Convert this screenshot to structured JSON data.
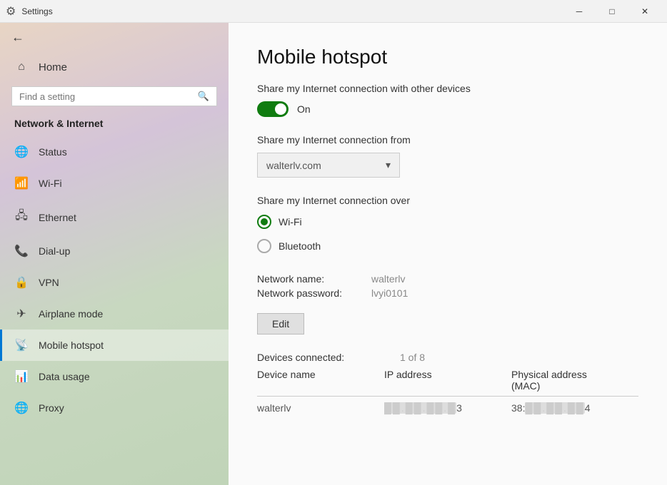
{
  "titleBar": {
    "title": "Settings",
    "minBtn": "─",
    "maxBtn": "□",
    "closeBtn": "✕"
  },
  "sidebar": {
    "backLabel": "",
    "homeLabel": "Home",
    "searchPlaceholder": "Find a setting",
    "sectionTitle": "Network & Internet",
    "items": [
      {
        "id": "status",
        "label": "Status",
        "icon": "🌐"
      },
      {
        "id": "wifi",
        "label": "Wi-Fi",
        "icon": "📶"
      },
      {
        "id": "ethernet",
        "label": "Ethernet",
        "icon": "🖧"
      },
      {
        "id": "dialup",
        "label": "Dial-up",
        "icon": "📞"
      },
      {
        "id": "vpn",
        "label": "VPN",
        "icon": "🔒"
      },
      {
        "id": "airplane",
        "label": "Airplane mode",
        "icon": "✈"
      },
      {
        "id": "hotspot",
        "label": "Mobile hotspot",
        "icon": "📡",
        "active": true
      },
      {
        "id": "datausage",
        "label": "Data usage",
        "icon": "📊"
      },
      {
        "id": "proxy",
        "label": "Proxy",
        "icon": "🌐"
      }
    ]
  },
  "main": {
    "pageTitle": "Mobile hotspot",
    "shareConnectionLabel": "Share my Internet connection with other devices",
    "toggleState": "On",
    "shareFromLabel": "Share my Internet connection from",
    "shareFromValue": "walterlv.com",
    "shareOverLabel": "Share my Internet connection over",
    "radioOptions": [
      {
        "id": "wifi",
        "label": "Wi-Fi",
        "selected": true
      },
      {
        "id": "bluetooth",
        "label": "Bluetooth",
        "selected": false
      }
    ],
    "networkNameLabel": "Network name:",
    "networkNameValue": "walterlv",
    "networkPasswordLabel": "Network password:",
    "networkPasswordValue": "lvyi0101",
    "editButtonLabel": "Edit",
    "devicesConnectedLabel": "Devices connected:",
    "devicesConnectedValue": "1 of 8",
    "tableHeaders": {
      "deviceName": "Device name",
      "ipAddress": "IP address",
      "physicalAddress": "Physical address\n(MAC)"
    },
    "deviceRows": [
      {
        "deviceName": "walterlv",
        "ipAddress": "██.██.██.█3",
        "macAddress": "38:██.██.██4"
      }
    ]
  }
}
